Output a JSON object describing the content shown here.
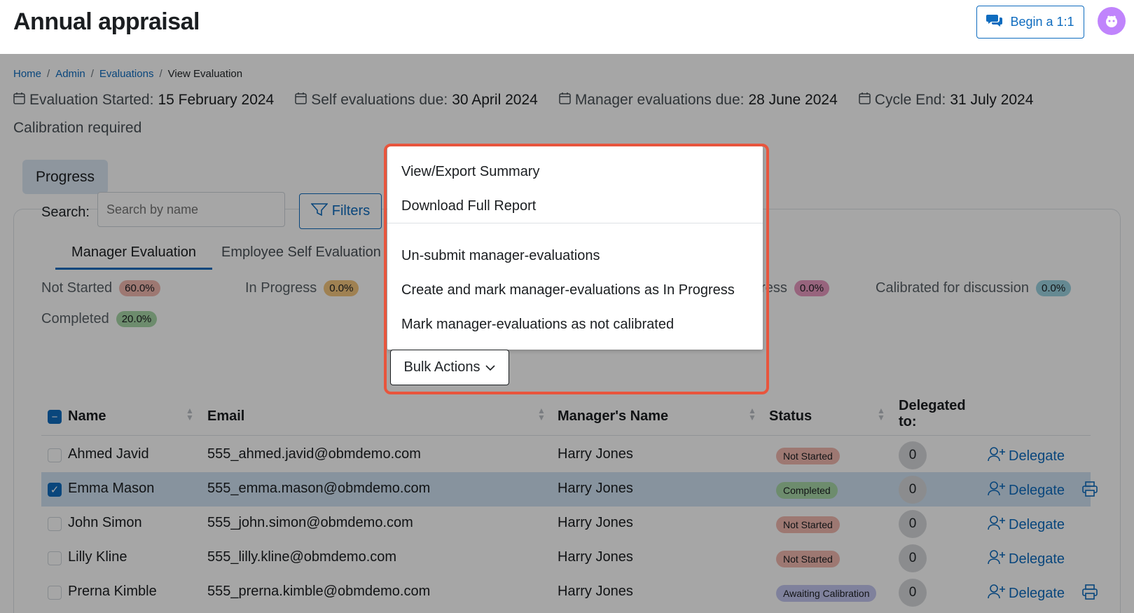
{
  "header": {
    "title": "Annual appraisal",
    "begin_label": "Begin a 1:1"
  },
  "breadcrumb": [
    "Home",
    "Admin",
    "Evaluations",
    "View Evaluation"
  ],
  "dates": [
    {
      "label": "Evaluation Started:",
      "value": "15 February 2024"
    },
    {
      "label": "Self evaluations due:",
      "value": "30 April 2024"
    },
    {
      "label": "Manager evaluations due:",
      "value": "28 June 2024"
    },
    {
      "label": "Cycle End:",
      "value": "31 July 2024"
    }
  ],
  "calibration_note": "Calibration required",
  "progress_label": "Progress",
  "tabs": {
    "active": "Manager Evaluation",
    "other": "Employee Self Evaluation"
  },
  "stats": {
    "not_started": {
      "label": "Not Started",
      "pct": "60.0%",
      "color": "#f1b8b0"
    },
    "in_progress": {
      "label": "In Progress",
      "pct": "0.0%",
      "color": "#f5c77e"
    },
    "awaiting_partial": {
      "label": "gress",
      "pct": "0.0%",
      "color": "#e89ac0"
    },
    "calibrated": {
      "label": "Calibrated for discussion",
      "pct": "0.0%",
      "color": "#9bd3e0"
    },
    "completed": {
      "label": "Completed",
      "pct": "20.0%",
      "color": "#a8d8a8"
    }
  },
  "search": {
    "label": "Search:",
    "placeholder": "Search by name"
  },
  "filters_label": "Filters",
  "bulk_label": "Bulk Actions",
  "columns": {
    "name": "Name",
    "email": "Email",
    "manager": "Manager's Name",
    "status": "Status",
    "delegated_line1": "Delegated",
    "delegated_line2": "to:"
  },
  "rows": [
    {
      "name": "Ahmed Javid",
      "email": "555_ahmed.javid@obmdemo.com",
      "manager": "Harry Jones",
      "status": "Not Started",
      "count": "0",
      "delegate": "Delegate"
    },
    {
      "name": "Emma Mason",
      "email": "555_emma.mason@obmdemo.com",
      "manager": "Harry Jones",
      "status": "Completed",
      "count": "0",
      "delegate": "Delegate"
    },
    {
      "name": "John Simon",
      "email": "555_john.simon@obmdemo.com",
      "manager": "Harry Jones",
      "status": "Not Started",
      "count": "0",
      "delegate": "Delegate"
    },
    {
      "name": "Lilly Kline",
      "email": "555_lilly.kline@obmdemo.com",
      "manager": "Harry Jones",
      "status": "Not Started",
      "count": "0",
      "delegate": "Delegate"
    },
    {
      "name": "Prerna Kimble",
      "email": "555_prerna.kimble@obmdemo.com",
      "manager": "Harry Jones",
      "status": "Awaiting Calibration",
      "count": "0",
      "delegate": "Delegate"
    }
  ],
  "status_colors": {
    "not_started": "#f1b8b0",
    "completed": "#a8d8a8",
    "awaiting": "#c4c6f0"
  },
  "menu": {
    "items": [
      "View/Export Summary",
      "Download Full Report",
      "Un-submit manager-evaluations",
      "Create and mark manager-evaluations as In Progress",
      "Mark manager-evaluations as not calibrated"
    ]
  },
  "accent": "#0f6cbf",
  "highlight": "#e8553d"
}
